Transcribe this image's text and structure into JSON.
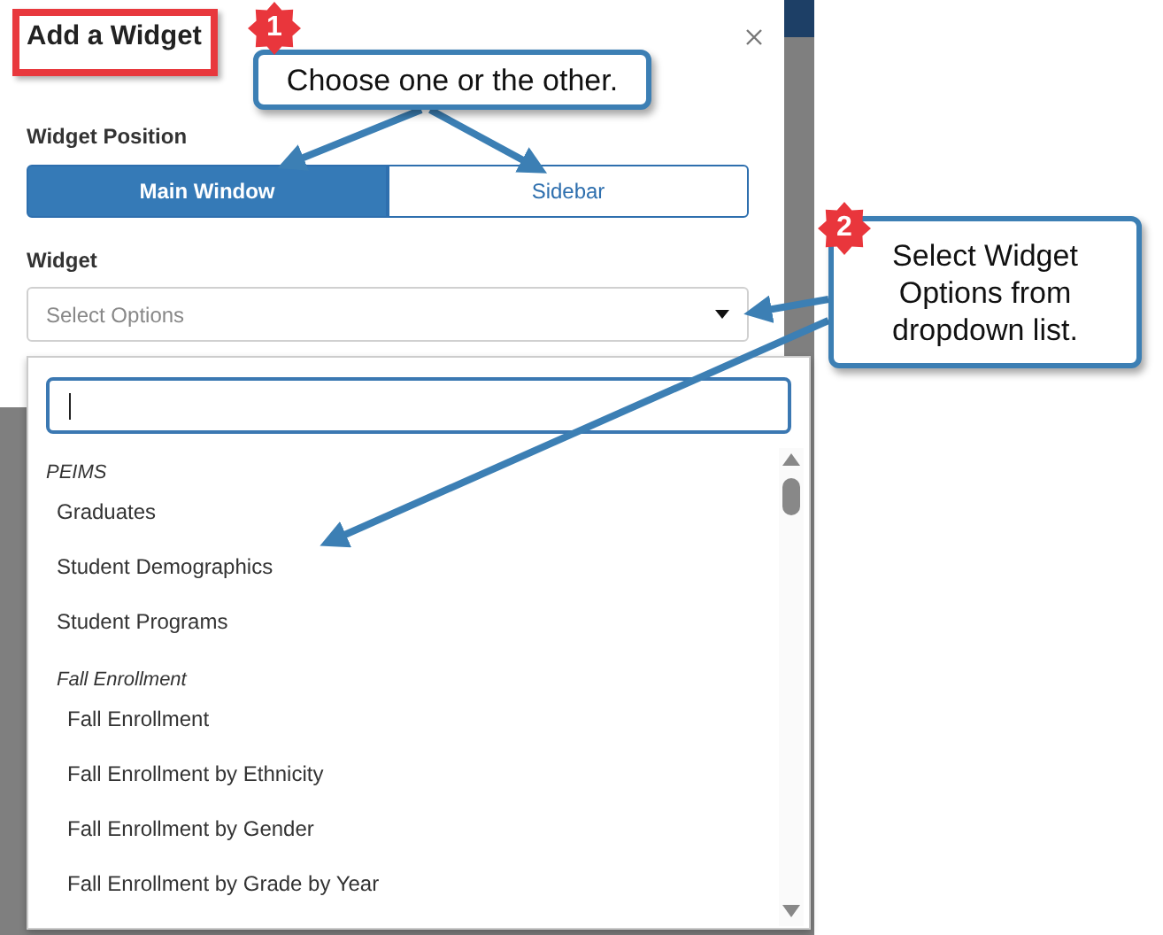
{
  "dialog": {
    "title": "Add a Widget",
    "position_label": "Widget Position",
    "positions": [
      {
        "label": "Main Window",
        "selected": true
      },
      {
        "label": "Sidebar",
        "selected": false
      }
    ],
    "widget_label": "Widget",
    "widget_select": {
      "placeholder": "Select Options"
    }
  },
  "dropdown": {
    "groups": [
      {
        "name": "PEIMS",
        "items": [
          "Graduates",
          "Student Demographics",
          "Student Programs"
        ]
      },
      {
        "name": "Fall Enrollment",
        "items": [
          "Fall Enrollment",
          "Fall Enrollment by Ethnicity",
          "Fall Enrollment by Gender",
          "Fall Enrollment by Grade by Year"
        ]
      }
    ]
  },
  "annotations": [
    {
      "number": "1",
      "text": "Choose one or the other."
    },
    {
      "number": "2",
      "text": "Select Widget Options from dropdown list."
    }
  ]
}
